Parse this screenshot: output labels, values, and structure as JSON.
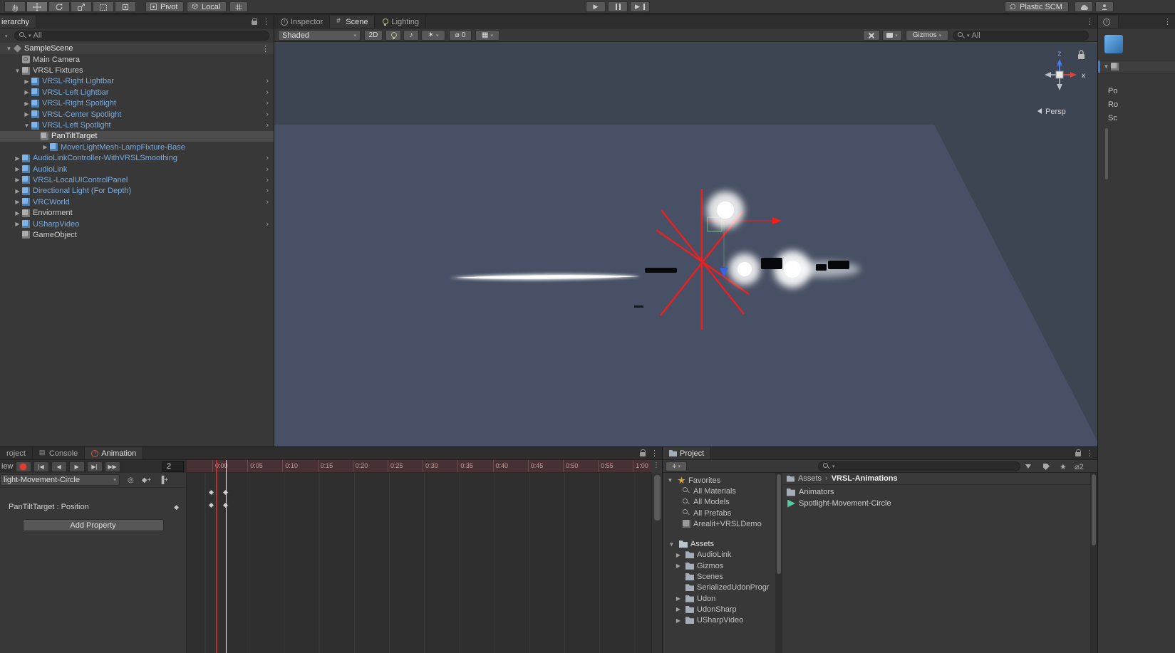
{
  "main_toolbar": {
    "pivot_label": "Pivot",
    "local_label": "Local",
    "plastic_scm_label": "Plastic SCM"
  },
  "hierarchy": {
    "tab_label": "ierarchy",
    "search_placeholder": "All",
    "scene_row": {
      "label": "SampleScene"
    },
    "items": [
      {
        "label": "Main Camera",
        "depth": 1,
        "icon": "camera",
        "arrow": "none",
        "color": "plain",
        "chevron": false,
        "selected": false
      },
      {
        "label": "VRSL Fixtures",
        "depth": 1,
        "icon": "cube-gray",
        "arrow": "down",
        "color": "plain",
        "chevron": false,
        "selected": false
      },
      {
        "label": "VRSL-Right Lightbar",
        "depth": 2,
        "icon": "cube-blue",
        "arrow": "right",
        "color": "prefab",
        "chevron": true,
        "selected": false
      },
      {
        "label": "VRSL-Left Lightbar",
        "depth": 2,
        "icon": "cube-blue",
        "arrow": "right",
        "color": "prefab",
        "chevron": true,
        "selected": false
      },
      {
        "label": "VRSL-Right Spotlight",
        "depth": 2,
        "icon": "cube-blue",
        "arrow": "right",
        "color": "prefab",
        "chevron": true,
        "selected": false
      },
      {
        "label": "VRSL-Center Spotlight",
        "depth": 2,
        "icon": "cube-blue",
        "arrow": "right",
        "color": "prefab",
        "chevron": true,
        "selected": false
      },
      {
        "label": "VRSL-Left Spotlight",
        "depth": 2,
        "icon": "cube-blue",
        "arrow": "down",
        "color": "prefab",
        "chevron": true,
        "selected": false
      },
      {
        "label": "PanTiltTarget",
        "depth": 3,
        "icon": "cube-gray",
        "arrow": "none",
        "color": "plain",
        "chevron": false,
        "selected": true
      },
      {
        "label": "MoverLightMesh-LampFixture-Base",
        "depth": 4,
        "icon": "cube-blue",
        "arrow": "right",
        "color": "prefab",
        "chevron": false,
        "selected": false
      },
      {
        "label": "AudioLinkController-WithVRSLSmoothing",
        "depth": 1,
        "icon": "cube-blue",
        "arrow": "right",
        "color": "prefab",
        "chevron": true,
        "selected": false
      },
      {
        "label": "AudioLink",
        "depth": 1,
        "icon": "cube-blue",
        "arrow": "right",
        "color": "prefab",
        "chevron": true,
        "selected": false
      },
      {
        "label": "VRSL-LocalUIControlPanel",
        "depth": 1,
        "icon": "cube-blue",
        "arrow": "right",
        "color": "prefab",
        "chevron": true,
        "selected": false
      },
      {
        "label": "Directional Light (For Depth)",
        "depth": 1,
        "icon": "cube-blue",
        "arrow": "right",
        "color": "prefab",
        "chevron": true,
        "selected": false
      },
      {
        "label": "VRCWorld",
        "depth": 1,
        "icon": "cube-blue",
        "arrow": "right",
        "color": "prefab",
        "chevron": true,
        "selected": false
      },
      {
        "label": "Enviorment",
        "depth": 1,
        "icon": "cube-gray",
        "arrow": "right",
        "color": "plain",
        "chevron": false,
        "selected": false
      },
      {
        "label": "USharpVideo",
        "depth": 1,
        "icon": "cube-blue",
        "arrow": "right",
        "color": "prefab",
        "chevron": true,
        "selected": false
      },
      {
        "label": "GameObject",
        "depth": 1,
        "icon": "cube-gray",
        "arrow": "none",
        "color": "plain",
        "chevron": false,
        "selected": false
      }
    ]
  },
  "scene_view": {
    "tabs": [
      {
        "label": "Inspector",
        "icon": "info",
        "active": false
      },
      {
        "label": "Scene",
        "icon": "grid",
        "active": true
      },
      {
        "label": "Lighting",
        "icon": "bulb",
        "active": false
      }
    ],
    "toolbar": {
      "draw_mode": "Shaded",
      "toggle_2d": "2D",
      "hidden_count": "0",
      "gizmos_label": "Gizmos",
      "search_placeholder": "All"
    },
    "gizmo": {
      "axis_z": "z",
      "axis_x": "x",
      "projection": "Persp"
    }
  },
  "inspector_strip": {
    "rows": [
      "Po",
      "Ro",
      "Sc"
    ]
  },
  "animation": {
    "tabs": [
      {
        "label": "roject",
        "icon": "",
        "active": false
      },
      {
        "label": "Console",
        "icon": "console",
        "active": false
      },
      {
        "label": "Animation",
        "icon": "clock",
        "active": true
      }
    ],
    "preview_label": "iew",
    "frame": "2",
    "ruler": [
      "0:00",
      "0:05",
      "0:10",
      "0:15",
      "0:20",
      "0:25",
      "0:30",
      "0:35",
      "0:40",
      "0:45",
      "0:50",
      "0:55",
      "1:00"
    ],
    "clip_name": "light-Movement-Circle",
    "property_row": "PanTiltTarget : Position",
    "add_property_label": "Add Property"
  },
  "project": {
    "tab_label": "Project",
    "favorites_header": "Favorites",
    "favorites": [
      {
        "label": "All Materials",
        "icon": "search"
      },
      {
        "label": "All Models",
        "icon": "search"
      },
      {
        "label": "All Prefabs",
        "icon": "search"
      },
      {
        "label": "Arealit+VRSLDemo",
        "icon": "cube-gray"
      }
    ],
    "assets_header": "Assets",
    "folders": [
      {
        "label": "AudioLink",
        "arrow": true
      },
      {
        "label": "Gizmos",
        "arrow": true
      },
      {
        "label": "Scenes",
        "arrow": false
      },
      {
        "label": "SerializedUdonProgr",
        "arrow": false
      },
      {
        "label": "Udon",
        "arrow": true
      },
      {
        "label": "UdonSharp",
        "arrow": true
      },
      {
        "label": "USharpVideo",
        "arrow": true
      }
    ],
    "breadcrumb": [
      "Assets",
      "VRSL-Animations"
    ],
    "content": [
      {
        "label": "Animators",
        "icon": "folder"
      },
      {
        "label": "Spotlight-Movement-Circle",
        "icon": "anim-clip"
      }
    ],
    "hidden_count": "2"
  },
  "colors": {
    "prefab_blue": "#7CABDD",
    "selection_gray": "#4D4D4D",
    "record_red": "#E33E31",
    "gizmo_red": "#FF1A1A",
    "scene_background": "#3D4452",
    "floor": "#475064",
    "accent_blue": "#3E7DE0",
    "anim_clip_teal": "#53C9A4"
  }
}
